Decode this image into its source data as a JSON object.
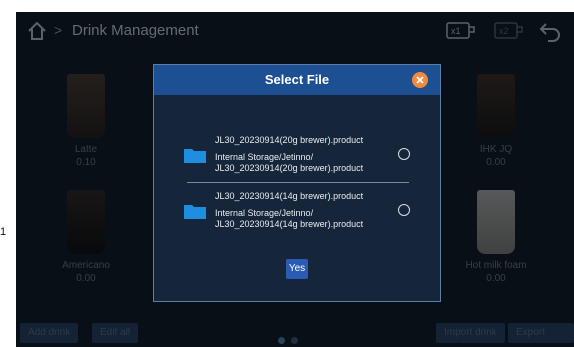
{
  "margin_text": "1",
  "header": {
    "title": "Drink Management",
    "separator": ">",
    "x1_label": "x1",
    "x2_label": "x2"
  },
  "drinks": [
    {
      "name": "Latte",
      "price": "0.10",
      "cup_color": "#3b2a1c"
    },
    {
      "name": "IHK JQ",
      "price": "0.00",
      "cup_color": "#2a1d14"
    },
    {
      "name": "Americano",
      "price": "0.00",
      "cup_color": "#1a1410"
    },
    {
      "name": "Hot milk foam",
      "price": "0.00",
      "cup_color": "#cfc9c0"
    }
  ],
  "bottom": {
    "add_drink": "Add drink",
    "edit_all": "Edit all",
    "import_drink": "Import drink",
    "export_drink": "Export drink"
  },
  "dialog": {
    "title": "Select File",
    "files": [
      {
        "name": "JL30_20230914(20g brewer).product",
        "path_line1": "Internal Storage/Jetinno/",
        "path_line2": "JL30_20230914(20g brewer).product"
      },
      {
        "name": "JL30_20230914(14g brewer).product",
        "path_line1": "Internal Storage/Jetinno/",
        "path_line2": "JL30_20230914(14g brewer).product"
      }
    ],
    "yes_label": "Yes"
  },
  "colors": {
    "screen_bg": "#0e1722",
    "dialog_bg": "#16263a",
    "dialog_header": "#1d4f93",
    "close_accent": "#f08a3e",
    "folder": "#1e8fe0",
    "yes_button": "#2b5cb5"
  }
}
